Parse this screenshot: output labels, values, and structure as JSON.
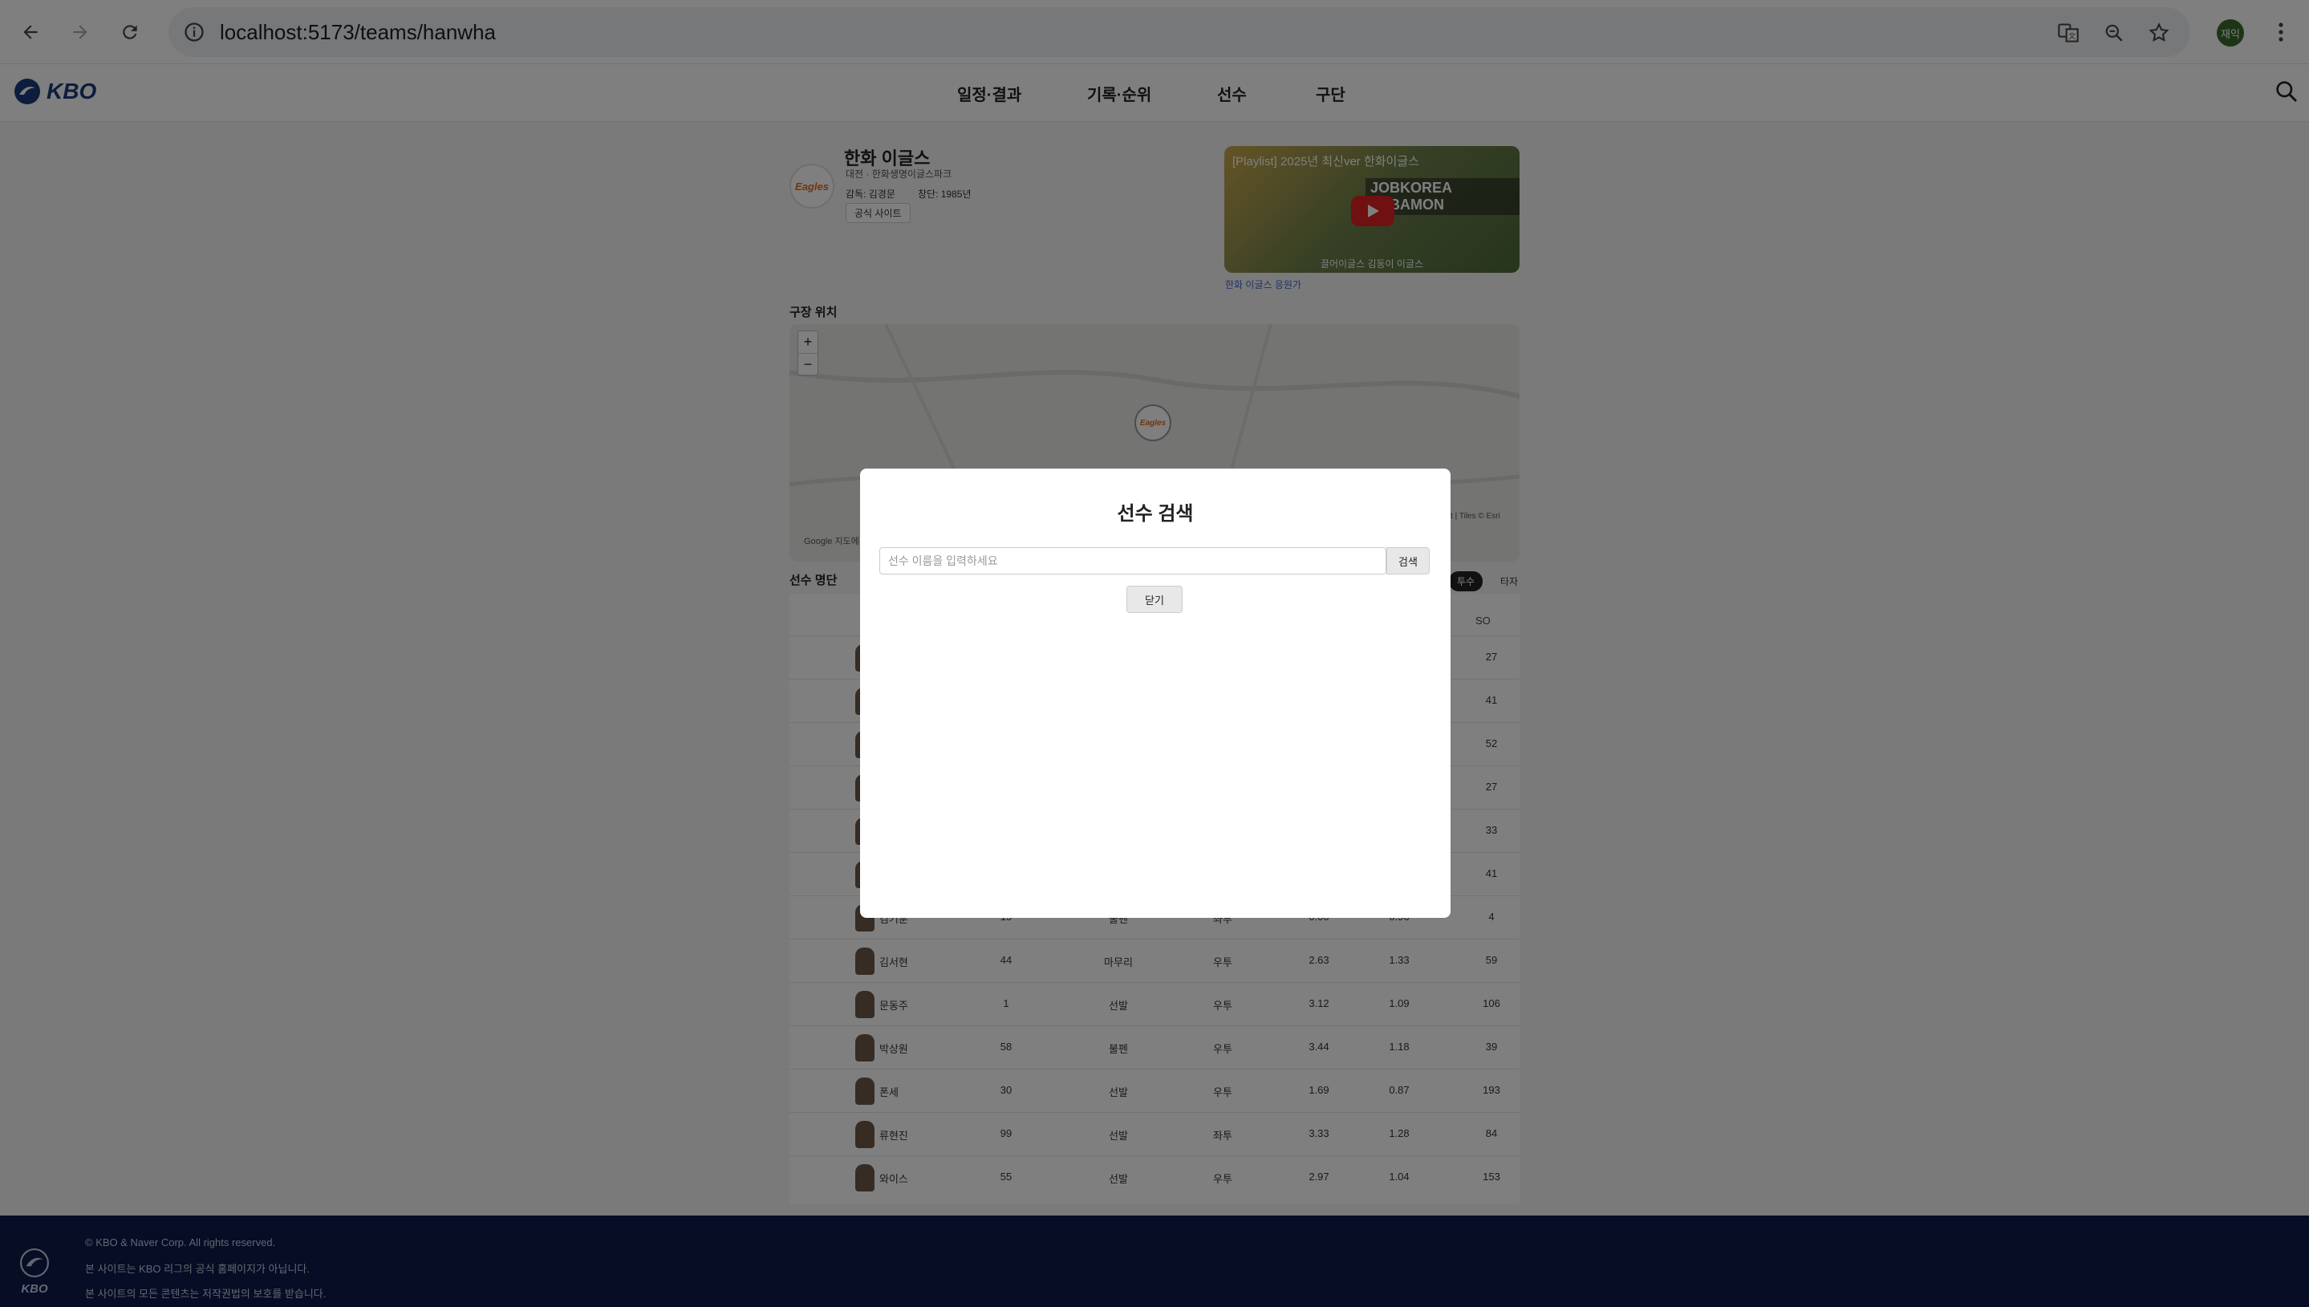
{
  "browser": {
    "url": "localhost:5173/teams/hanwha",
    "profile_initial": "재익"
  },
  "header": {
    "logo_text": "KBO",
    "nav": [
      "일정·결과",
      "기록·순위",
      "선수",
      "구단"
    ]
  },
  "team": {
    "name": "한화 이글스",
    "stadium": "대전 · 한화생명이글스파크",
    "manager": "감독: 김경문",
    "founded": "창단: 1985년",
    "official_site": "공식 사이트",
    "logo_text": "Eagles",
    "video_title": "[Playlist] 2025년 최신ver 한화이글스",
    "video_banner": "JOBKOREA ALBAMON",
    "video_caption": "한화 이글스 응원가",
    "video_subtitle": "끌어이글스 김동이 이글스"
  },
  "map": {
    "section_title": "구장 위치",
    "zoom_in": "+",
    "zoom_out": "−",
    "attribution_left": "Google 지도에서",
    "attribution_right": "aflet | Tiles © Esri"
  },
  "roster": {
    "section_title": "선수 명단",
    "toggle_pitcher": "투수",
    "toggle_batter": "타자",
    "col_so": "SO",
    "hidden_so": [
      "27",
      "41",
      "52",
      "27",
      "33",
      "41"
    ],
    "rows": [
      {
        "name": "김기훈",
        "number": "15",
        "role": "불펜",
        "hand": "좌투",
        "era": "0.00",
        "whip": "0.96",
        "so": "4"
      },
      {
        "name": "김서현",
        "number": "44",
        "role": "마무리",
        "hand": "우투",
        "era": "2.63",
        "whip": "1.33",
        "so": "59"
      },
      {
        "name": "문동주",
        "number": "1",
        "role": "선발",
        "hand": "우투",
        "era": "3.12",
        "whip": "1.09",
        "so": "106"
      },
      {
        "name": "박상원",
        "number": "58",
        "role": "불펜",
        "hand": "우투",
        "era": "3.44",
        "whip": "1.18",
        "so": "39"
      },
      {
        "name": "폰세",
        "number": "30",
        "role": "선발",
        "hand": "우투",
        "era": "1.69",
        "whip": "0.87",
        "so": "193"
      },
      {
        "name": "류현진",
        "number": "99",
        "role": "선발",
        "hand": "좌투",
        "era": "3.33",
        "whip": "1.28",
        "so": "84"
      },
      {
        "name": "와이스",
        "number": "55",
        "role": "선발",
        "hand": "우투",
        "era": "2.97",
        "whip": "1.04",
        "so": "153"
      }
    ]
  },
  "footer": {
    "logo_text": "KBO",
    "lines": [
      "© KBO & Naver Corp. All rights reserved.",
      "본 사이트는 KBO 리그의 공식 홈페이지가 아닙니다.",
      "본 사이트의 모든 콘텐츠는 저작권법의 보호를 받습니다."
    ]
  },
  "modal": {
    "title": "선수 검색",
    "input_placeholder": "선수 이름을 입력하세요",
    "search_button": "검색",
    "close_button": "닫기"
  }
}
